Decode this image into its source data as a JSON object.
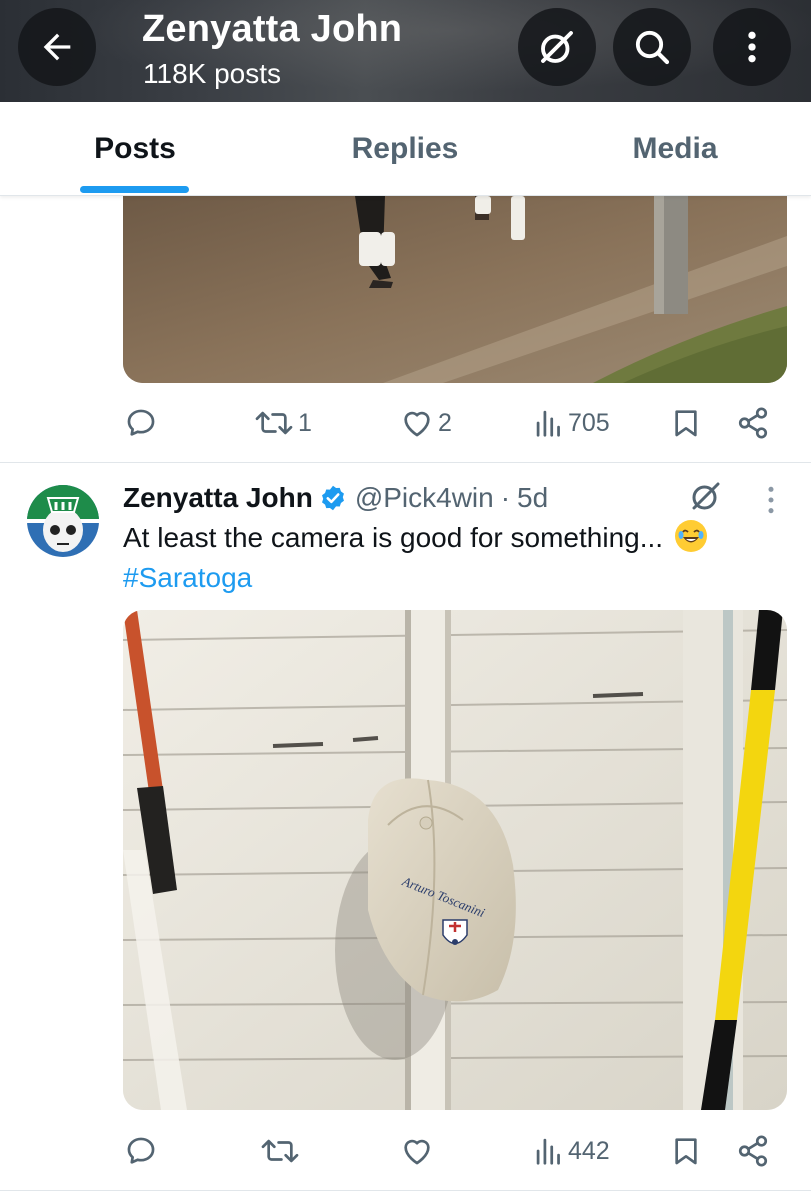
{
  "header": {
    "title": "Zenyatta John",
    "subtitle": "118K posts"
  },
  "tabs": [
    {
      "label": "Posts",
      "active": true
    },
    {
      "label": "Replies",
      "active": false
    },
    {
      "label": "Media",
      "active": false
    }
  ],
  "posts": [
    {
      "media_description": "",
      "actions": {
        "replies": "",
        "reposts": "1",
        "likes": "2",
        "views": "705"
      }
    },
    {
      "author": "Zenyatta John",
      "handle": "@Pick4win",
      "separator": "·",
      "time": "5d",
      "text": "At least the camera is good for something...",
      "hashtag": "#Saratoga",
      "cap_text": "Arturo Toscanini",
      "actions": {
        "replies": "",
        "reposts": "",
        "likes": "",
        "views": "442"
      }
    }
  ],
  "icons": {
    "back": "arrow-left-icon",
    "grok": "grok-icon",
    "search": "search-icon",
    "more": "more-vertical-icon",
    "reply": "reply-icon",
    "repost": "repost-icon",
    "like": "heart-icon",
    "views": "views-icon",
    "bookmark": "bookmark-icon",
    "share": "share-icon",
    "verified": "verified-badge-icon"
  },
  "colors": {
    "accent": "#1d9bf0",
    "text_primary": "#0f1419",
    "text_secondary": "#536471"
  }
}
